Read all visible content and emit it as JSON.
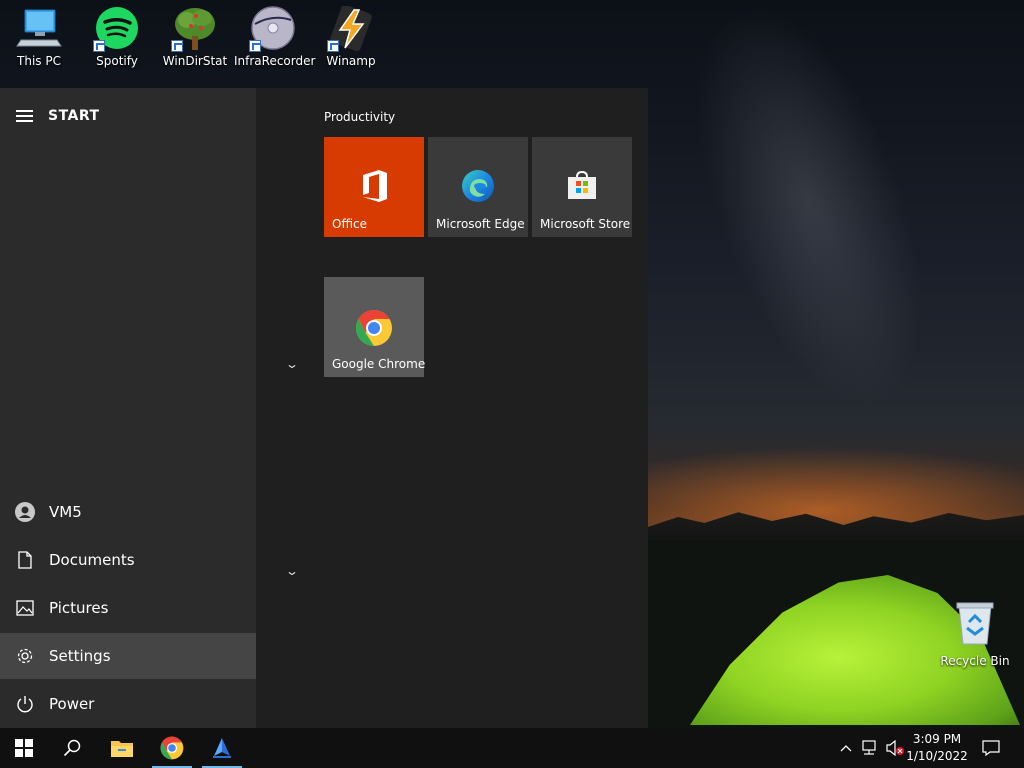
{
  "desktop": {
    "icons": [
      {
        "label": "This PC"
      },
      {
        "label": "Spotify"
      },
      {
        "label": "WinDirStat"
      },
      {
        "label": "InfraRecorder"
      },
      {
        "label": "Winamp"
      }
    ],
    "recycle_bin": {
      "label": "Recycle Bin"
    }
  },
  "start_menu": {
    "title": "START",
    "nav": [
      {
        "label": "VM5",
        "icon": "user-icon"
      },
      {
        "label": "Documents",
        "icon": "document-icon"
      },
      {
        "label": "Pictures",
        "icon": "pictures-icon"
      },
      {
        "label": "Settings",
        "icon": "gear-icon",
        "active": true
      },
      {
        "label": "Power",
        "icon": "power-icon"
      }
    ],
    "group_label": "Productivity",
    "tiles": [
      {
        "label": "Office",
        "color": "#d83b01"
      },
      {
        "label": "Microsoft Edge",
        "color": "#3a3a3a"
      },
      {
        "label": "Microsoft Store",
        "color": "#3a3a3a"
      },
      {
        "label": "Google Chrome",
        "color": "#5a5a5a"
      }
    ]
  },
  "taskbar": {
    "time": "3:09 PM",
    "date": "1/10/2022"
  },
  "colors": {
    "accent": "#76b9ed",
    "office": "#d83b01"
  }
}
